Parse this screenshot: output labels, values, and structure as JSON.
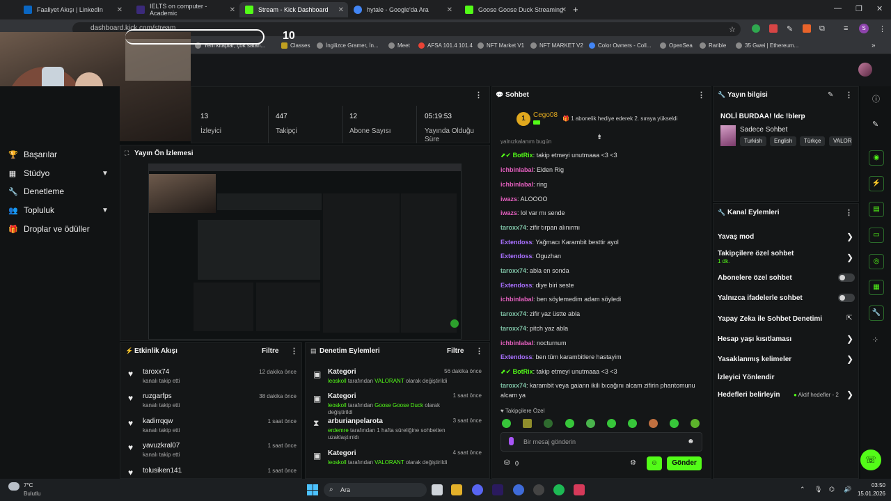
{
  "tabs": [
    {
      "label": "Faaliyet Akışı | LinkedIn",
      "color": "#0a66c2"
    },
    {
      "label": "IELTS on computer - Academic",
      "color": "#3b2a7a"
    },
    {
      "label": "Stream - Kick Dashboard",
      "color": "#53fc18"
    },
    {
      "label": "hytale - Google'da Ara",
      "color": "#4285f4"
    },
    {
      "label": "Goose Goose Duck Streaming",
      "color": "#53fc18"
    }
  ],
  "url": "dashboard.kick.com/stream",
  "bookmarks": [
    "Yeni kitaplar, çok satan...",
    "Classes",
    "İngilizce Gramer, İn...",
    "Meet",
    "AFSA 101.4 101.4",
    "NFT Market V1",
    "NFT MARKET V2",
    "Color Owners - Coll...",
    "OpenSea",
    "Rarible",
    "35 Gwei | Ethereum..."
  ],
  "webcam_counter": "10",
  "nav": [
    {
      "label": "Başarılar",
      "icon": "trophy-icon",
      "glyph": "🏆",
      "chev": false
    },
    {
      "label": "Stüdyo",
      "icon": "studio-icon",
      "glyph": "▦",
      "chev": true
    },
    {
      "label": "Denetleme",
      "icon": "wrench-icon",
      "glyph": "🔧",
      "chev": false
    },
    {
      "label": "Topluluk",
      "icon": "community-icon",
      "glyph": "👥",
      "chev": true
    },
    {
      "label": "Droplar ve ödüller",
      "icon": "gift-icon",
      "glyph": "🎁",
      "chev": false
    }
  ],
  "stats": [
    {
      "value": "13",
      "label": "İzleyici"
    },
    {
      "value": "447",
      "label": "Takipçi"
    },
    {
      "value": "12",
      "label": "Abone Sayısı"
    },
    {
      "value": "05:19:53",
      "label": "Yayında Olduğu Süre"
    }
  ],
  "preview_title": "Yayın Ön İzlemesi",
  "activity": {
    "title": "Etkinlik Akışı",
    "filter": "Filtre",
    "items": [
      {
        "name": "taroxx74",
        "sub": "kanalı takip etti",
        "time": "12 dakika önce"
      },
      {
        "name": "ruzgarfps",
        "sub": "kanalı takip etti",
        "time": "38 dakika önce"
      },
      {
        "name": "kadirrqqw",
        "sub": "kanalı takip etti",
        "time": "1 saat önce"
      },
      {
        "name": "yavuzkral07",
        "sub": "kanalı takip etti",
        "time": "1 saat önce"
      },
      {
        "name": "tolusiken141",
        "sub": "",
        "time": "1 saat önce"
      }
    ]
  },
  "mod": {
    "title": "Denetim Eylemleri",
    "filter": "Filtre",
    "items": [
      {
        "title": "Kategori",
        "user": "leoskoll",
        "mid": " tarafından ",
        "value": "VALORANT",
        "tail": " olarak değiştirildi",
        "time": "56 dakika önce",
        "icon": "category-icon",
        "glyph": "▣"
      },
      {
        "title": "Kategori",
        "user": "leoskoll",
        "mid": " tarafından ",
        "value": "Goose Goose Duck",
        "tail": " olarak değiştirildi",
        "time": "1 saat önce",
        "icon": "category-icon",
        "glyph": "▣"
      },
      {
        "title": "arburianpelarota",
        "user": "erdemre",
        "mid": " tarafından 1 hafta süreliğine sohbetten uzaklaştırıldı",
        "value": "",
        "tail": "",
        "time": "3 saat önce",
        "icon": "hourglass-icon",
        "glyph": "⧗"
      },
      {
        "title": "Kategori",
        "user": "leoskoll",
        "mid": " tarafından ",
        "value": "VALORANT",
        "tail": " olarak değiştirildi",
        "time": "4 saat önce",
        "icon": "category-icon",
        "glyph": "▣"
      }
    ]
  },
  "chat": {
    "title": "Sohbet",
    "pinned_user": "Cego08",
    "pinned_text": "1 abonelik hediye ederek 2. sıraya yükseldi",
    "partial_top": "yalnızkalanım bugün",
    "messages": [
      {
        "user": "BotRix",
        "cls": "u-bot",
        "text": "takip etmeyi unutmaaa <3 <3",
        "bot": true
      },
      {
        "user": "ichbinlabal",
        "cls": "u-pink",
        "text": "Elden Rig"
      },
      {
        "user": "ichbinlabal",
        "cls": "u-pink",
        "text": "ring"
      },
      {
        "user": "iwazs",
        "cls": "u-pink",
        "text": "ALOOOO"
      },
      {
        "user": "iwazs",
        "cls": "u-pink",
        "text": "lol var mı sende"
      },
      {
        "user": "taroxx74",
        "cls": "u-green",
        "text": "zifir tırpan alınırmı"
      },
      {
        "user": "Extendoss",
        "cls": "u-purple",
        "text": "Yağmacı Karambit besttir ayol"
      },
      {
        "user": "Extendoss",
        "cls": "u-purple",
        "text": "Oguzhan"
      },
      {
        "user": "taroxx74",
        "cls": "u-green",
        "text": "abla en sonda"
      },
      {
        "user": "Extendoss",
        "cls": "u-purple",
        "text": "diye biri seste"
      },
      {
        "user": "ichbinlabal",
        "cls": "u-pink",
        "text": "ben söylemedim adam söyledi"
      },
      {
        "user": "taroxx74",
        "cls": "u-green",
        "text": "zifir yaz üstte abla"
      },
      {
        "user": "taroxx74",
        "cls": "u-green",
        "text": "pitch yaz abla"
      },
      {
        "user": "ichbinlabal",
        "cls": "u-pink",
        "text": "nocturnum"
      },
      {
        "user": "Extendoss",
        "cls": "u-purple",
        "text": "ben tüm karambitlere hastayim"
      },
      {
        "user": "BotRix",
        "cls": "u-bot",
        "text": "takip etmeyi unutmaaa <3 <3",
        "bot": true
      },
      {
        "user": "taroxx74",
        "cls": "u-green",
        "text": "karambit veya gaiann ikili bıcağını alcam zifirin phantomunu alcam ya"
      }
    ],
    "followers_only": "Takipçilere Özel",
    "input_placeholder": "Bir mesaj gönderin",
    "points": "0",
    "send": "Gönder"
  },
  "stream_info": {
    "title": "Yayın bilgisi",
    "stream_title": "NOLİ BURDAA! !dc !blerp",
    "category": "Sadece Sohbet",
    "tags": [
      "Turkish",
      "English",
      "Türkçe",
      "VALOR"
    ]
  },
  "channel_actions": {
    "title": "Kanal Eylemleri",
    "slow": "Yavaş mod",
    "followers": "Takipçilere özel sohbet",
    "followers_sub": "1 dk.",
    "subs": "Abonelere özel sohbet",
    "emotes": "Yalnızca ifadelerle sohbet",
    "ai": "Yapay Zeka ile Sohbet Denetimi",
    "age": "Hesap yaşı kısıtlaması",
    "banned": "Yasaklanmış kelimeler",
    "raid": "İzleyici Yönlendir",
    "goals": "Hedefleri belirleyin",
    "goals_sub": "Aktif hedefler - 2"
  },
  "taskbar": {
    "weather_temp": "7°C",
    "weather_desc": "Bulutlu",
    "search": "Ara",
    "time": "03:50",
    "date": "15.01.2026"
  },
  "colors": {
    "kick_green": "#53fc18",
    "bg": "#0b0e0f",
    "panel": "#141617"
  }
}
